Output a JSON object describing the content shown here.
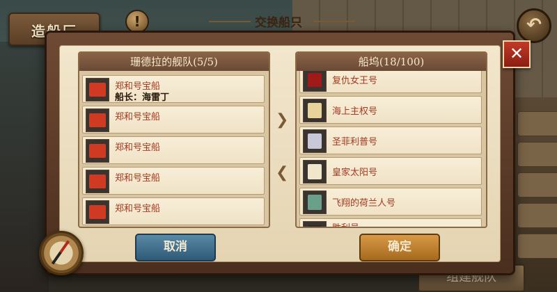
{
  "hud": {
    "shipyard_label": "造船厂",
    "alert_symbol": "!",
    "back_symbol": "↶",
    "build_fleet_label": "组建舰队"
  },
  "dialog": {
    "title": "交换船只",
    "close_symbol": "✕",
    "fleet_panel": {
      "header": "珊德拉的舰队(5/5)",
      "ships": [
        {
          "name": "郑和号宝船",
          "captain": "船长：海雷丁",
          "icon": "treasure-ship-icon"
        },
        {
          "name": "郑和号宝船",
          "captain": "",
          "icon": "treasure-ship-icon"
        },
        {
          "name": "郑和号宝船",
          "captain": "",
          "icon": "treasure-ship-icon"
        },
        {
          "name": "郑和号宝船",
          "captain": "",
          "icon": "treasure-ship-icon"
        },
        {
          "name": "郑和号宝船",
          "captain": "",
          "icon": "treasure-ship-icon"
        }
      ]
    },
    "dock_panel": {
      "header": "船坞(18/100)",
      "ships": [
        {
          "name": "复仇女王号",
          "icon": "queen-anne-ship-icon"
        },
        {
          "name": "海上主权号",
          "icon": "sovereign-ship-icon"
        },
        {
          "name": "圣菲利普号",
          "icon": "san-felipe-ship-icon"
        },
        {
          "name": "皇家太阳号",
          "icon": "royal-sun-ship-icon"
        },
        {
          "name": "飞翔的荷兰人号",
          "icon": "flying-dutchman-ship-icon"
        },
        {
          "name": "胜利号",
          "icon": "victory-ship-icon"
        }
      ]
    },
    "move_right_symbol": "❯",
    "move_left_symbol": "❮",
    "cancel_label": "取消",
    "confirm_label": "确定"
  },
  "colors": {
    "ship_name": "#a43a20",
    "cancel_button": "#3e6e8c",
    "confirm_button": "#c0822e",
    "close_button": "#b22e1e"
  }
}
